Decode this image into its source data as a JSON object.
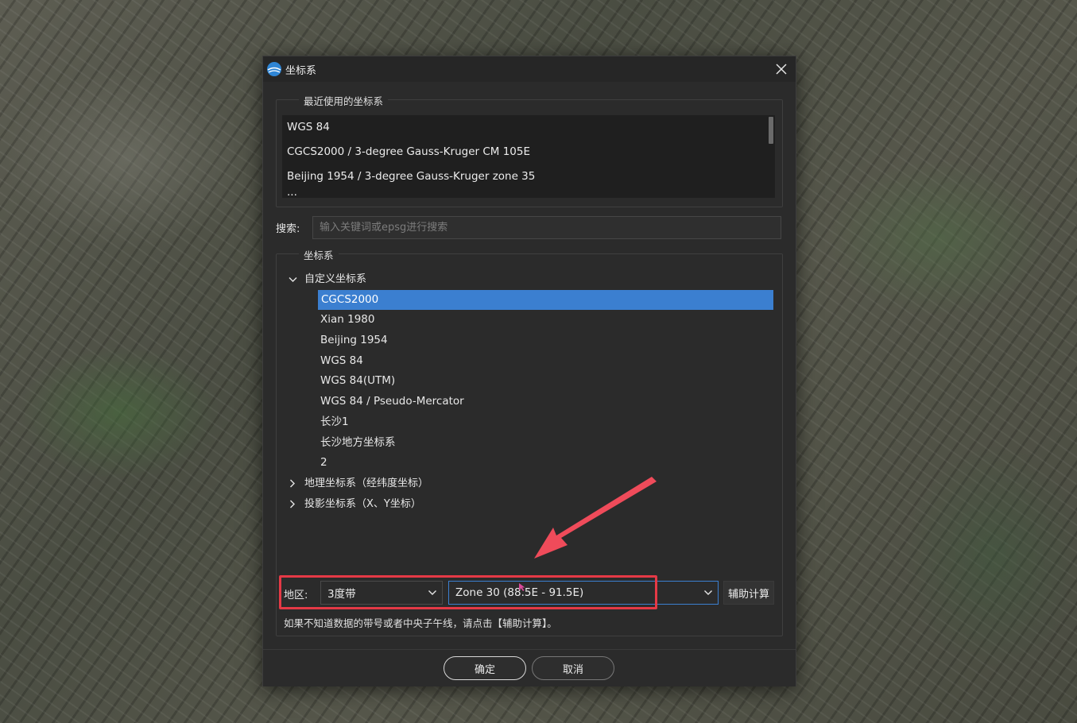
{
  "dialog": {
    "title": "坐标系",
    "recent_group_title": "最近使用的坐标系",
    "recent_items": [
      "WGS 84",
      "CGCS2000 / 3-degree Gauss-Kruger CM 105E",
      "Beijing 1954 / 3-degree Gauss-Kruger zone 35",
      "..."
    ],
    "search": {
      "label": "搜索:",
      "placeholder": "输入关键词或epsg进行搜索",
      "value": ""
    },
    "crs_group_title": "坐标系",
    "tree": {
      "custom_label": "自定义坐标系",
      "custom_children": [
        "CGCS2000",
        "Xian 1980",
        "Beijing 1954",
        "WGS 84",
        "WGS 84(UTM)",
        "WGS 84 / Pseudo-Mercator",
        "长沙1",
        "长沙地方坐标系",
        "2"
      ],
      "selected": "CGCS2000",
      "geographic_label": "地理坐标系（经纬度坐标）",
      "projected_label": "投影坐标系（X、Y坐标）"
    },
    "region": {
      "label": "地区:",
      "band_value": "3度带",
      "zone_value": "Zone 30 (88.5E - 91.5E)",
      "assist_button": "辅助计算",
      "hint": "如果不知道数据的带号或者中央子午线，请点击【辅助计算】。"
    },
    "buttons": {
      "ok": "确定",
      "cancel": "取消"
    }
  },
  "colors": {
    "selection": "#3b7fd0",
    "highlight_box": "#e53946",
    "dialog_bg": "#2b2b2b"
  }
}
